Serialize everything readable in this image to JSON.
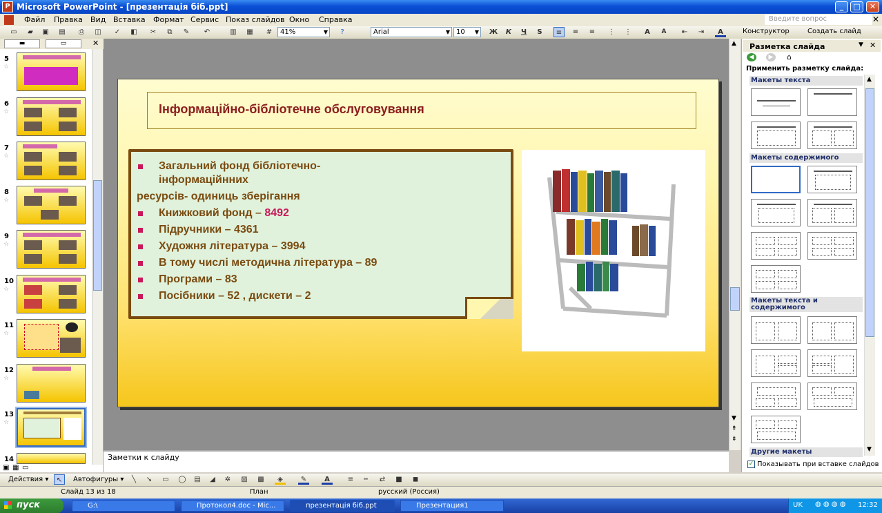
{
  "window": {
    "title": "Microsoft PowerPoint - [презентація біб.ppt]",
    "min": "_",
    "max": "□",
    "close": "✕"
  },
  "menu": {
    "items": [
      "Файл",
      "Правка",
      "Вид",
      "Вставка",
      "Формат",
      "Сервис",
      "Показ слайдов",
      "Окно",
      "Справка"
    ],
    "help_placeholder": "Введите вопрос"
  },
  "toolbar": {
    "zoom": "41%",
    "font": "Arial",
    "size": "10",
    "bold": "Ж",
    "italic": "К",
    "underline": "Ч",
    "shadow": "S",
    "designer": "Конструктор",
    "new_slide": "Создать слайд"
  },
  "slides_pane": {
    "numbers": [
      "5",
      "6",
      "7",
      "8",
      "9",
      "10",
      "11",
      "12",
      "13",
      "14"
    ],
    "selected": "13"
  },
  "slide": {
    "title": "Інформаційно-бібліотечне обслуговування",
    "bullets": [
      "Загальний фонд бібліотечно-",
      "інформаційнних",
      "ресурсів- одиниць зберігання",
      "Книжковий фонд – ",
      "8492",
      "Підручники – 4361",
      "Художня література – 3994",
      "В тому числі методична література – 89",
      "Програми – 83",
      "Посібники – 52 , дискети – 2"
    ]
  },
  "notes": {
    "placeholder": "Заметки к слайду"
  },
  "task_pane": {
    "title": "Разметка слайда",
    "apply": "Применить разметку слайда:",
    "sections": {
      "text": "Макеты текста",
      "content": "Макеты содержимого",
      "text_content": "Макеты текста и содержимого",
      "other": "Другие макеты"
    },
    "show_checkbox": "Показывать при вставке слайдов"
  },
  "drawing_toolbar": {
    "actions": "Действия",
    "autoshapes": "Автофигуры"
  },
  "status": {
    "slide": "Слайд 13 из 18",
    "design": "План",
    "language": "русский (Россия)"
  },
  "taskbar": {
    "start": "пуск",
    "tasks": [
      "G:\\",
      "Протокол4.doc - Mic...",
      "презентація біб.ppt",
      "Презентация1"
    ],
    "lang": "UK",
    "time": "12:32"
  }
}
